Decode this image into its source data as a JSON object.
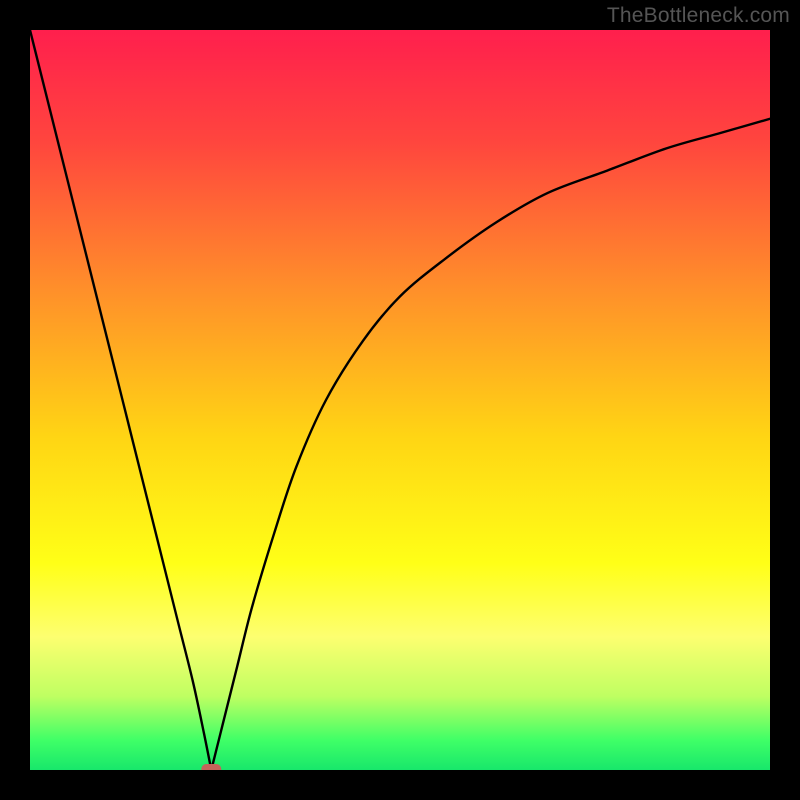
{
  "watermark": {
    "text": "TheBottleneck.com"
  },
  "chart_data": {
    "type": "line",
    "title": "",
    "xlabel": "",
    "ylabel": "",
    "xlim": [
      0,
      100
    ],
    "ylim": [
      0,
      100
    ],
    "grid": false,
    "legend": false,
    "annotations": [],
    "note": "Values estimated from gridless plot with gradient background red→yellow→green",
    "series": [
      {
        "name": "curve-left",
        "x": [
          0,
          2,
          5,
          8,
          11,
          14,
          17,
          20,
          22,
          23.5,
          24.5
        ],
        "y": [
          100,
          92,
          80,
          68,
          56,
          44,
          32,
          20,
          12,
          5,
          0
        ]
      },
      {
        "name": "curve-right",
        "x": [
          24.5,
          26,
          28,
          30,
          33,
          36,
          40,
          45,
          50,
          56,
          63,
          70,
          78,
          86,
          93,
          100
        ],
        "y": [
          0,
          6,
          14,
          22,
          32,
          41,
          50,
          58,
          64,
          69,
          74,
          78,
          81,
          84,
          86,
          88
        ]
      },
      {
        "name": "baseline",
        "x": [
          0,
          100
        ],
        "y": [
          0,
          0
        ]
      }
    ],
    "marker": {
      "shape": "rounded-rect",
      "x": 24.5,
      "y": 0,
      "color": "#c4645a"
    },
    "background_gradient": [
      {
        "stop": 0.0,
        "color": "#ff1f4d"
      },
      {
        "stop": 0.15,
        "color": "#ff453e"
      },
      {
        "stop": 0.35,
        "color": "#ff8f2a"
      },
      {
        "stop": 0.55,
        "color": "#ffd514"
      },
      {
        "stop": 0.72,
        "color": "#ffff17"
      },
      {
        "stop": 0.82,
        "color": "#fdff70"
      },
      {
        "stop": 0.9,
        "color": "#bfff62"
      },
      {
        "stop": 0.96,
        "color": "#3fff67"
      },
      {
        "stop": 1.0,
        "color": "#18e76b"
      }
    ]
  }
}
